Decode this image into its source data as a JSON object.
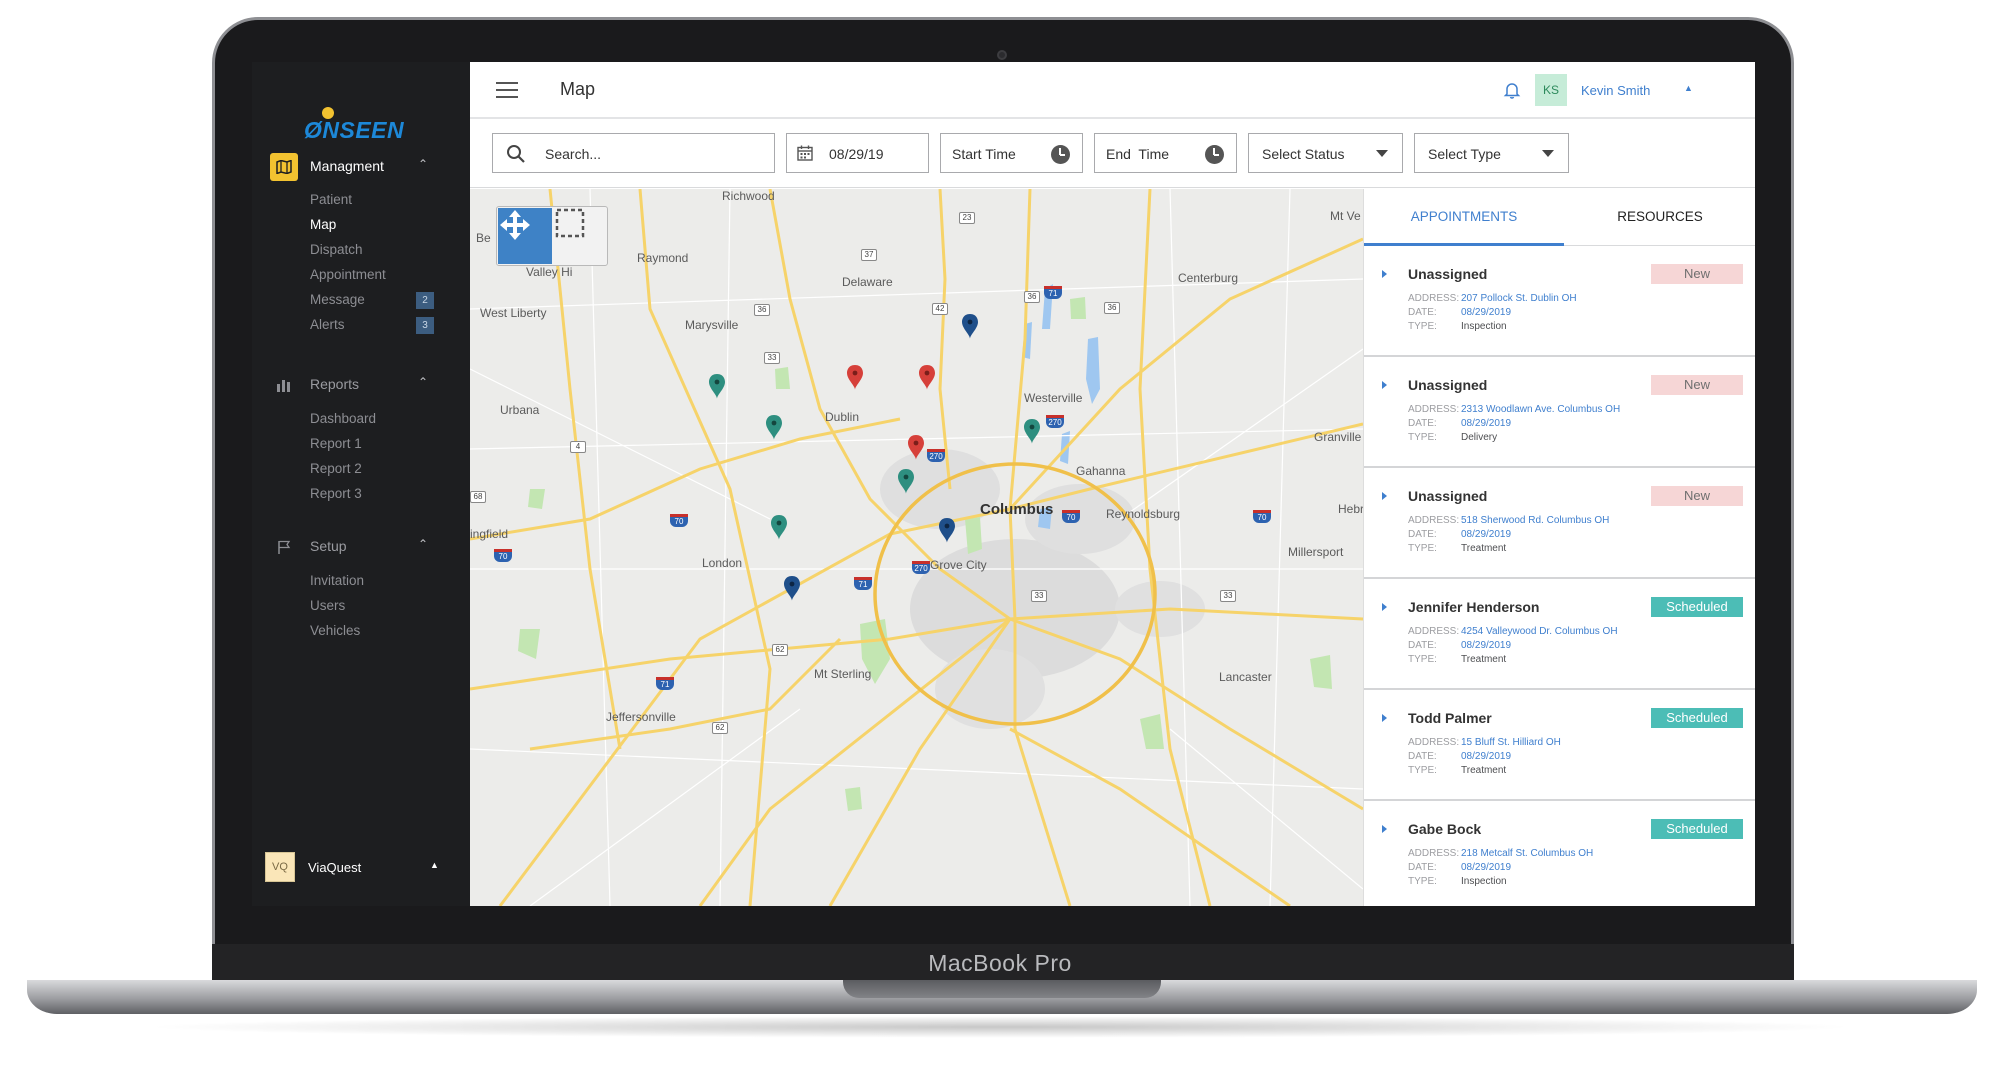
{
  "device": {
    "label": "MacBook Pro"
  },
  "sidebar": {
    "logo_text": "ØNSEEN",
    "sections": [
      {
        "title": "Managment",
        "icon": "map-icon",
        "expanded": true,
        "items": [
          {
            "label": "Patient"
          },
          {
            "label": "Map",
            "current": true
          },
          {
            "label": "Dispatch"
          },
          {
            "label": "Appointment"
          },
          {
            "label": "Message",
            "badge": "2"
          },
          {
            "label": "Alerts",
            "badge": "3"
          }
        ]
      },
      {
        "title": "Reports",
        "icon": "bar-chart-icon",
        "expanded": true,
        "items": [
          {
            "label": "Dashboard"
          },
          {
            "label": "Report 1"
          },
          {
            "label": "Report 2"
          },
          {
            "label": "Report 3"
          }
        ]
      },
      {
        "title": "Setup",
        "icon": "flag-icon",
        "expanded": true,
        "items": [
          {
            "label": "Invitation"
          },
          {
            "label": "Users"
          },
          {
            "label": "Vehicles"
          }
        ]
      }
    ],
    "org": {
      "avatar": "VQ",
      "name": "ViaQuest"
    }
  },
  "topbar": {
    "title": "Map",
    "user_initials": "KS",
    "user_name": "Kevin Smith"
  },
  "filters": {
    "search_placeholder": "Search...",
    "date": "08/29/19",
    "start_time": "Start Time",
    "end_time": "End  Time",
    "status": "Select Status",
    "type": "Select Type"
  },
  "map": {
    "places": {
      "richwood": "Richwood",
      "raymond": "Raymond",
      "valley_hi": "Valley Hi",
      "west_liberty": "West Liberty",
      "marysville": "Marysville",
      "delaware": "Delaware",
      "centerburg": "Centerburg",
      "mt_vernon": "Mt Ve",
      "be": "Be",
      "urbana": "Urbana",
      "dublin": "Dublin",
      "westerville": "Westerville",
      "granville": "Granville",
      "gahanna": "Gahanna",
      "columbus": "Columbus",
      "reynoldsburg": "Reynoldsburg",
      "hebron": "Hebr",
      "springfield": "ingfield",
      "london": "London",
      "grove_city": "Grove City",
      "millersport": "Millersport",
      "mt_sterling": "Mt Sterling",
      "lancaster": "Lancaster",
      "jeffersonville": "Jeffersonville"
    },
    "routes": [
      "23",
      "37",
      "36",
      "42",
      "36",
      "71",
      "36",
      "33",
      "4",
      "270",
      "270",
      "68",
      "70",
      "70",
      "71",
      "270",
      "70",
      "33",
      "62",
      "71",
      "62",
      "70",
      "33"
    ],
    "markers": {
      "status_colors": {
        "new": "#d6403a",
        "scheduled": "#2e8f80",
        "assigned": "#1f4f8a"
      }
    }
  },
  "panel": {
    "tabs": {
      "appointments": "APPOINTMENTS",
      "resources": "RESOURCES"
    },
    "labels": {
      "address": "ADDRESS:",
      "date": "DATE:",
      "type": "TYPE:"
    },
    "cards": [
      {
        "name": "Unassigned",
        "status": "New",
        "address": "207 Pollock St.  Dublin  OH",
        "date": "08/29/2019",
        "type": "Inspection"
      },
      {
        "name": "Unassigned",
        "status": "New",
        "address": "2313 Woodlawn Ave.  Columbus  OH",
        "date": "08/29/2019",
        "type": "Delivery"
      },
      {
        "name": "Unassigned",
        "status": "New",
        "address": "518 Sherwood Rd.  Columbus  OH",
        "date": "08/29/2019",
        "type": "Treatment"
      },
      {
        "name": "Jennifer Henderson",
        "status": "Scheduled",
        "address": "4254 Valleywood Dr.  Columbus  OH",
        "date": "08/29/2019",
        "type": "Treatment"
      },
      {
        "name": "Todd Palmer",
        "status": "Scheduled",
        "address": "15 Bluff St.  Hilliard  OH",
        "date": "08/29/2019",
        "type": "Treatment"
      },
      {
        "name": "Gabe Bock",
        "status": "Scheduled",
        "address": "218 Metcalf St.  Columbus  OH",
        "date": "08/29/2019",
        "type": "Inspection"
      }
    ]
  }
}
